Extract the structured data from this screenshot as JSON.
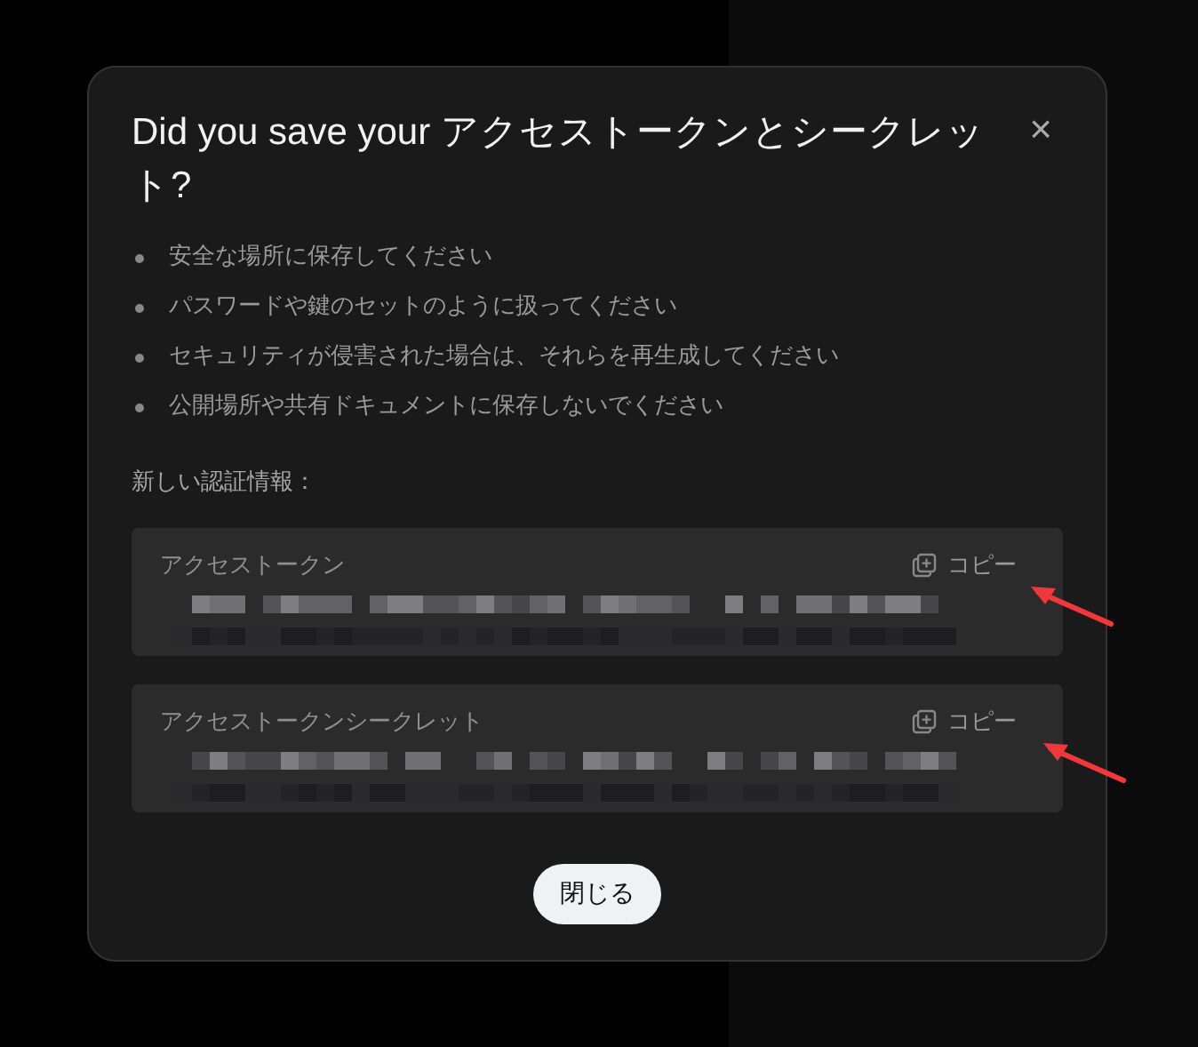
{
  "dialog": {
    "title": "Did you save your アクセストークンとシークレット?",
    "close": "×",
    "tips": [
      "安全な場所に保存してください",
      "パスワードや鍵のセットのように扱ってください",
      "セキュリティが侵害された場合は、それらを再生成してください",
      "公開場所や共有ドキュメントに保存しないでください"
    ],
    "credentials_label": "新しい認証情報：",
    "credentials": [
      {
        "label": "アクセストークン",
        "copy": "コピー"
      },
      {
        "label": "アクセストークンシークレット",
        "copy": "コピー"
      }
    ],
    "close_button": "閉じる"
  }
}
